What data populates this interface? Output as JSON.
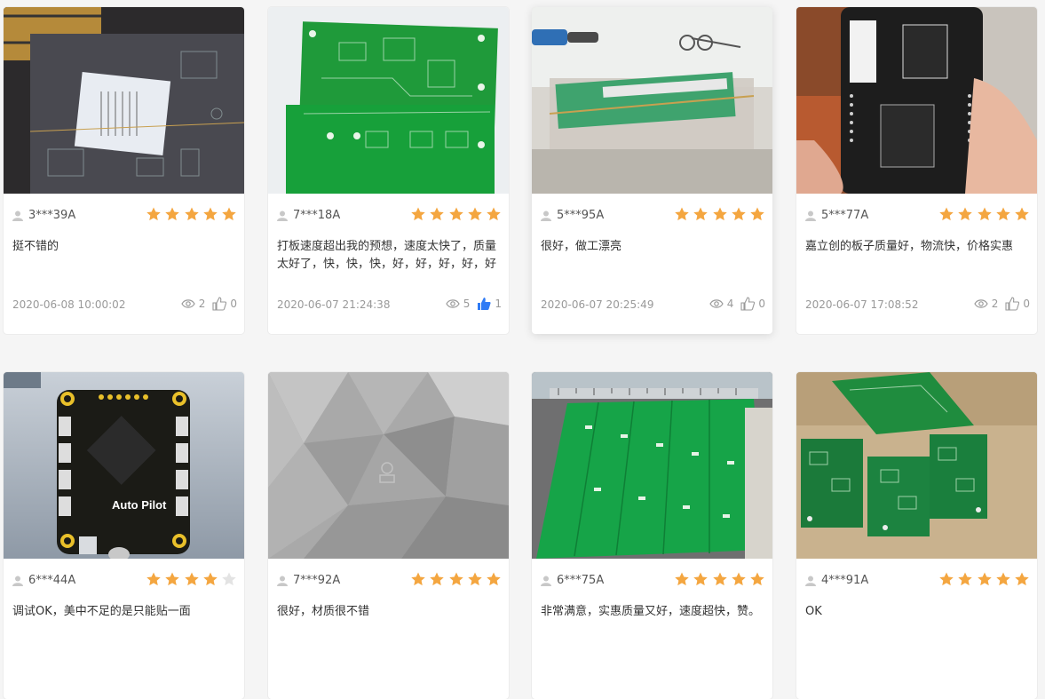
{
  "colors": {
    "star_on": "#f4a640",
    "star_off": "#e3e3e3",
    "like_active": "#2f7bf5"
  },
  "reviews": [
    {
      "user": "3***39A",
      "rating": 5,
      "text": "挺不错的",
      "date": "2020-06-08 10:00:02",
      "views": "2",
      "likes": "0",
      "liked": false
    },
    {
      "user": "7***18A",
      "rating": 5,
      "text": "打板速度超出我的预想，速度太快了，质量太好了，快，快，快，好，好，好，好，好",
      "date": "2020-06-07 21:24:38",
      "views": "5",
      "likes": "1",
      "liked": true
    },
    {
      "user": "5***95A",
      "rating": 5,
      "text": "很好，做工漂亮",
      "date": "2020-06-07 20:25:49",
      "views": "4",
      "likes": "0",
      "liked": false
    },
    {
      "user": "5***77A",
      "rating": 5,
      "text": "嘉立创的板子质量好，物流快，价格实惠",
      "date": "2020-06-07 17:08:52",
      "views": "2",
      "likes": "0",
      "liked": false
    },
    {
      "user": "6***44A",
      "rating": 4,
      "text": "调试OK，美中不足的是只能贴一面"
    },
    {
      "user": "7***92A",
      "rating": 5,
      "text": "很好，材质很不错"
    },
    {
      "user": "6***75A",
      "rating": 5,
      "text": "非常满意，实惠质量又好，速度超快，赞。"
    },
    {
      "user": "4***91A",
      "rating": 5,
      "text": "OK"
    }
  ],
  "photos": {
    "p5": {
      "board_label": "Auto Pilot"
    }
  }
}
